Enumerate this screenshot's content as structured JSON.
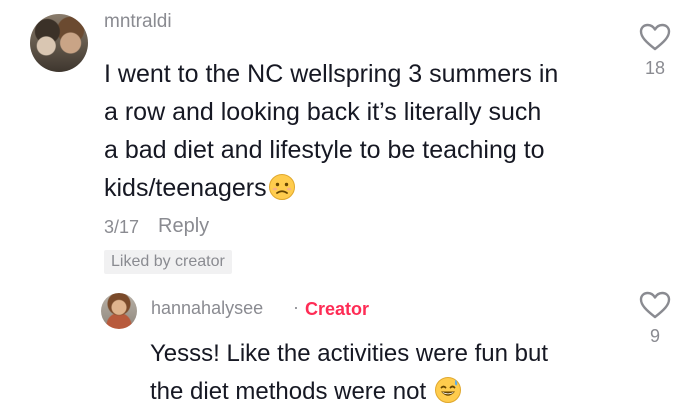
{
  "comments": [
    {
      "username": "mntraldi",
      "lines": [
        "I went to the NC wellspring 3 summers in",
        "a row and looking back it’s literally such",
        "a bad diet and lifestyle to be teaching to",
        "kids/teenagers"
      ],
      "emoji": "slightly-sad-face-emoji",
      "date": "3/17",
      "reply_label": "Reply",
      "liked_by_creator_label": "Liked by creator",
      "like_count": "18"
    },
    {
      "username": "hannahalysee",
      "separator": "·",
      "badge": "Creator",
      "lines": [
        "Yesss! Like the activities were fun but",
        "the diet methods were not"
      ],
      "emoji": "sweat-smile-emoji",
      "like_count": "9"
    }
  ],
  "colors": {
    "text": "#161823",
    "muted": "#8a8b91",
    "creator": "#fe2c55",
    "chip_bg": "#f1f1f2"
  }
}
